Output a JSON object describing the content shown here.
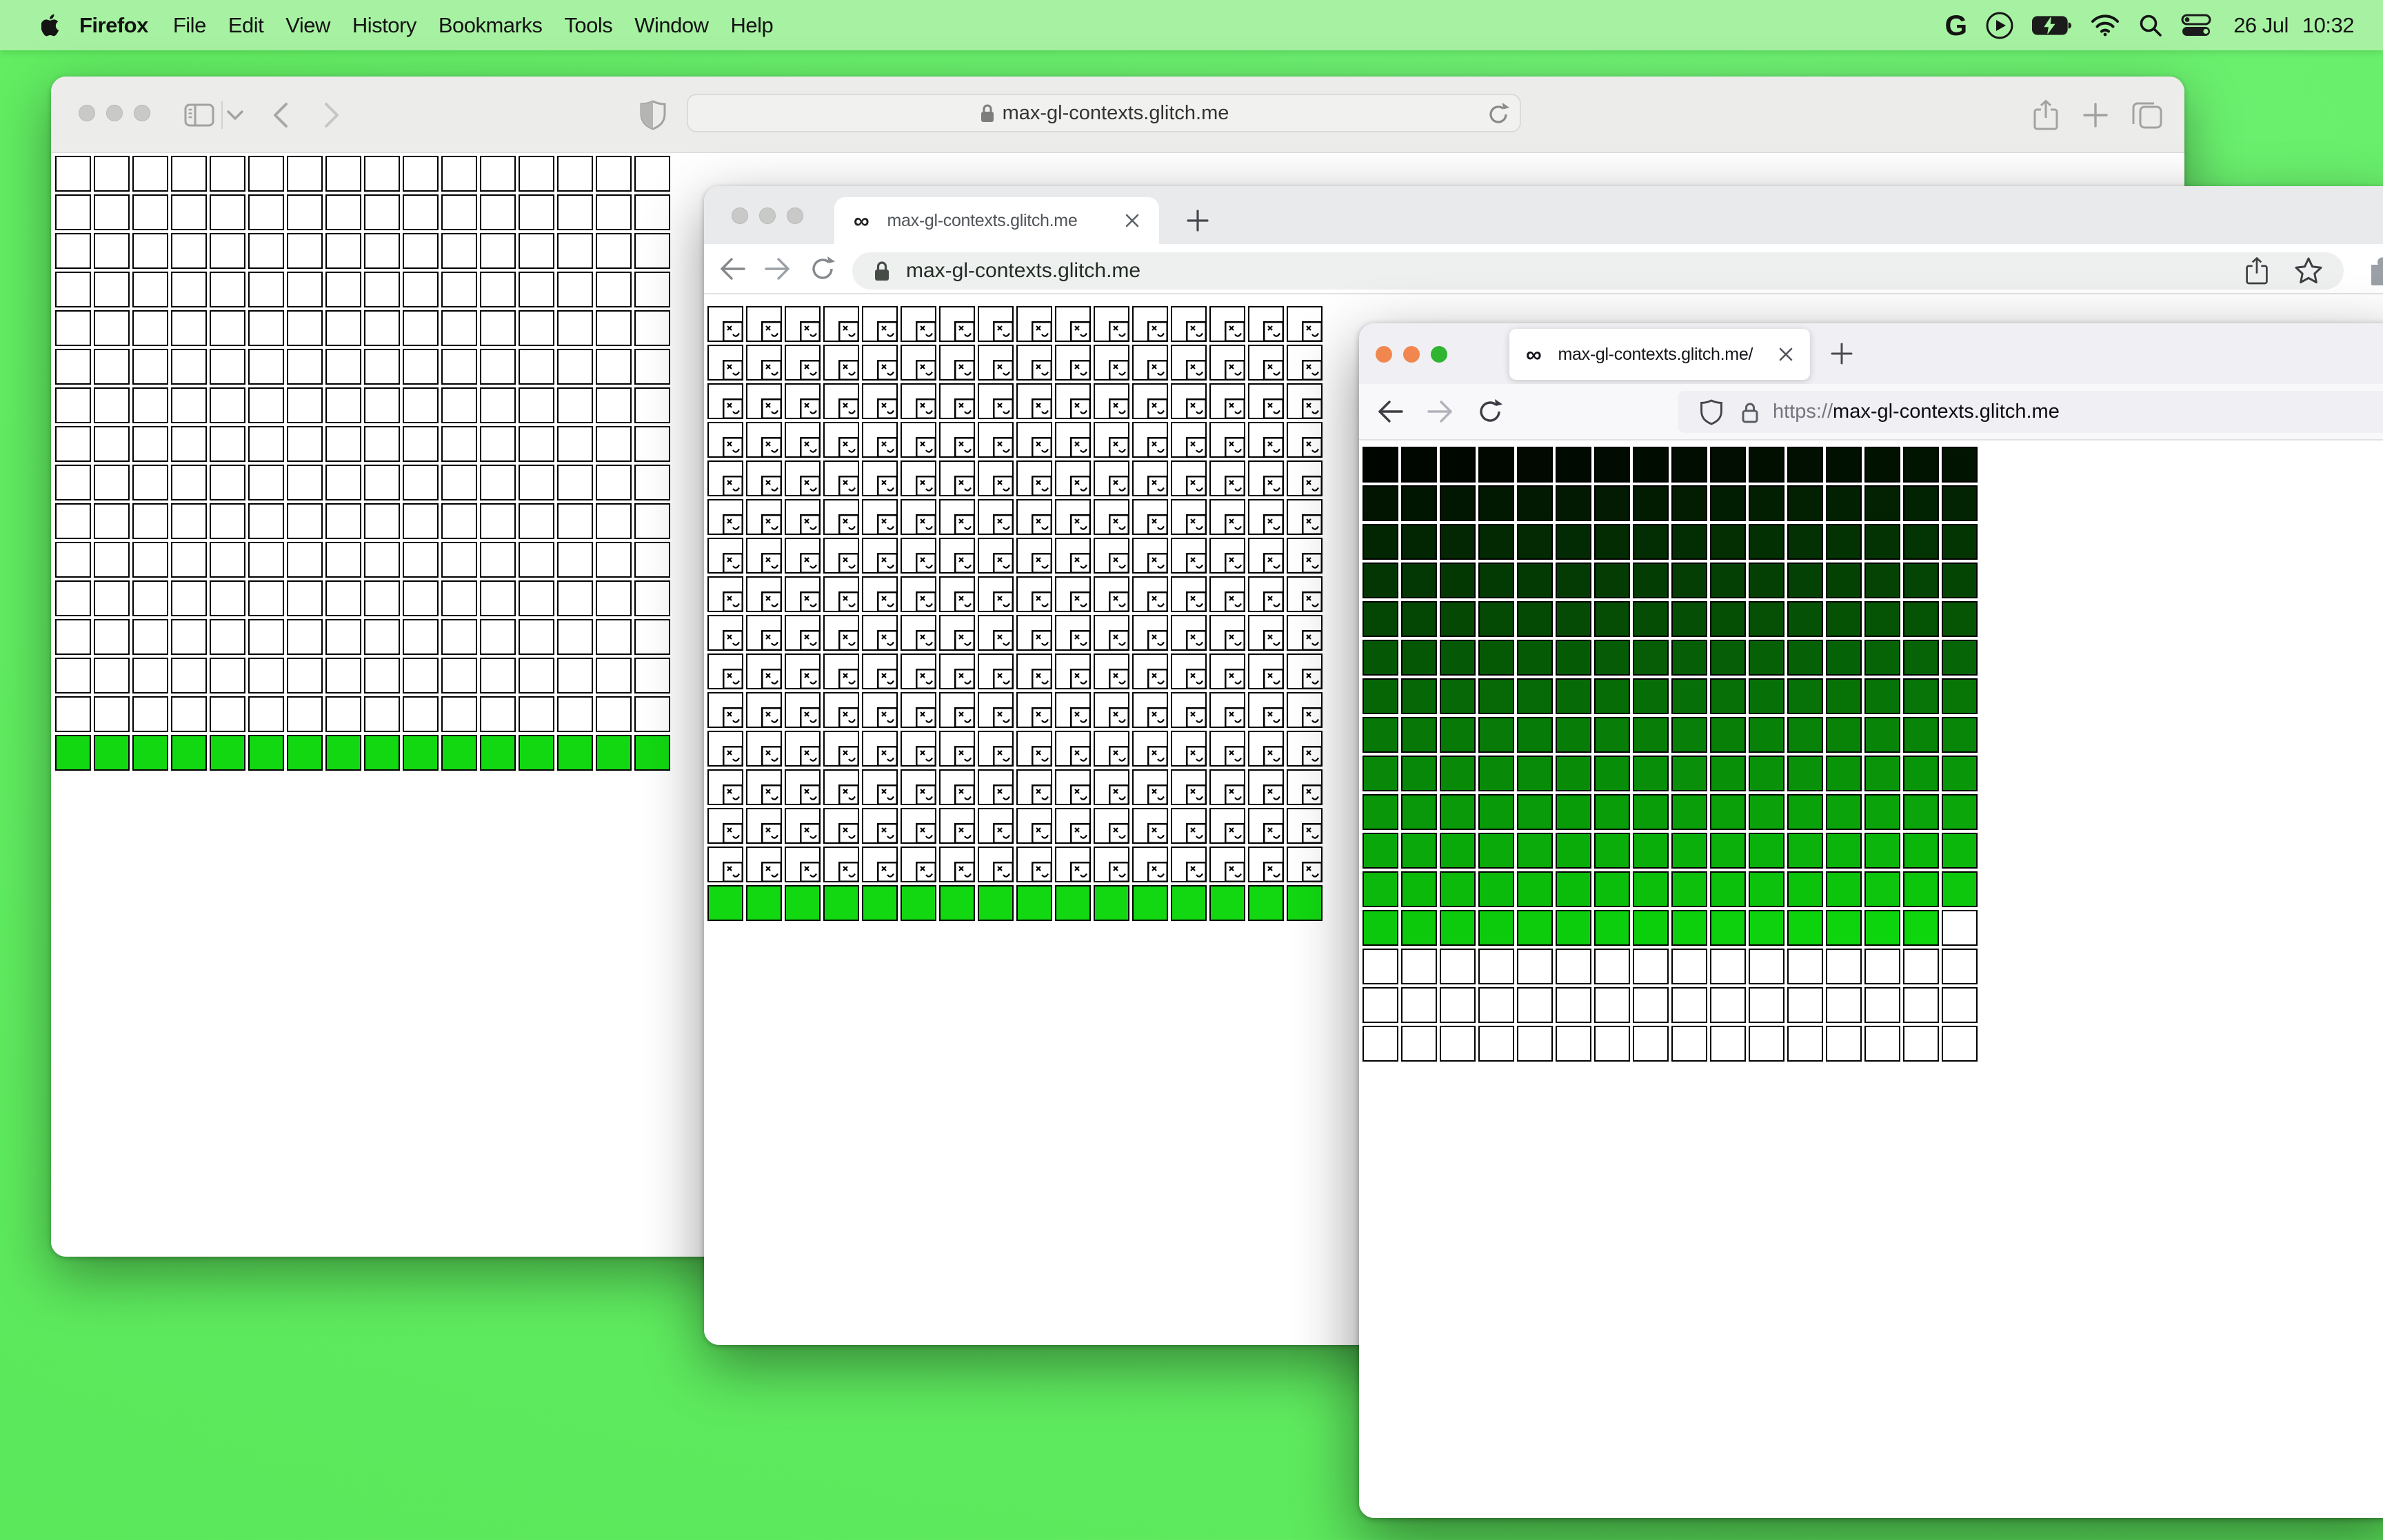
{
  "menu_bar": {
    "app_name": "Firefox",
    "items": [
      "File",
      "Edit",
      "View",
      "History",
      "Bookmarks",
      "Tools",
      "Window",
      "Help"
    ],
    "status_icons": [
      "google-icon",
      "play-circle-icon",
      "battery-charging-icon",
      "wifi-icon",
      "search-icon",
      "control-center-icon"
    ],
    "google_glyph": "G",
    "date": "26 Jul",
    "time": "10:32"
  },
  "safari": {
    "url": "max-gl-contexts.glitch.me",
    "grid": {
      "type": "heatmap",
      "cols": 16,
      "rows": 16,
      "pattern": "blank-then-green",
      "blank_cells": 240,
      "green_cells": 16,
      "green": "#12d812",
      "border": "#000000"
    }
  },
  "chrome": {
    "tab_title": "max-gl-contexts.glitch.me",
    "url": "max-gl-contexts.glitch.me",
    "new_tab_glyph": "+",
    "close_glyph": "✕",
    "favicon_glyph": "∞",
    "grid": {
      "type": "heatmap",
      "cols": 16,
      "rows": 16,
      "pattern": "broken-then-green",
      "broken_cells": 240,
      "green_cells": 16,
      "green": "#12d812",
      "border": "#000000"
    }
  },
  "firefox": {
    "tab_title": "max-gl-contexts.glitch.me/",
    "url_scheme": "https://",
    "url_host": "max-gl-contexts.glitch.me",
    "new_tab_glyph": "+",
    "close_glyph": "✕",
    "favicon_glyph": "∞",
    "grid": {
      "type": "heatmap",
      "cols": 16,
      "rows": 16,
      "pattern": "green-gradient",
      "colored_cells": 207,
      "g_start": 5,
      "g_end": 214,
      "white_cells": 49,
      "border": "#000000"
    }
  },
  "colors": {
    "desktop": "#5eeb5e",
    "menubar": "#a7f2a2",
    "traffic_inactive": "#c9c9c7",
    "ff_traffic_1": "#f1874f",
    "ff_traffic_2": "#f1874f",
    "ff_traffic_3": "#30b530",
    "canvas_green": "#12d812"
  }
}
